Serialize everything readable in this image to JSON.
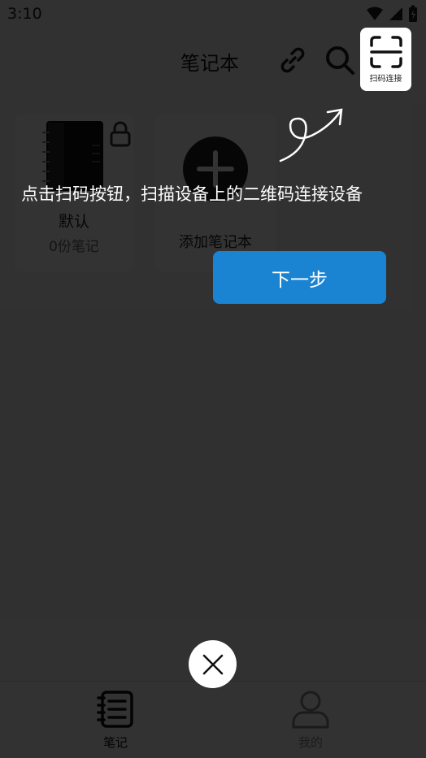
{
  "status_bar": {
    "time": "3:10"
  },
  "header": {
    "title": "笔记本"
  },
  "notebooks": [
    {
      "name": "默认",
      "count": "0份笔记",
      "locked": true
    },
    {
      "name": "添加笔记本"
    }
  ],
  "bottom_nav": [
    {
      "label": "笔记",
      "icon": "notebook-icon",
      "active": true
    },
    {
      "label": "我的",
      "icon": "person-icon",
      "active": false
    }
  ],
  "guide": {
    "spotlight_label": "扫码连接",
    "hint": "点击扫码按钮，扫描设备上的二维码连接设备",
    "next_label": "下一步"
  },
  "colors": {
    "accent": "#1a84d3",
    "overlay": "rgba(0,0,0,0.80)",
    "background": "#f2f2f2"
  }
}
